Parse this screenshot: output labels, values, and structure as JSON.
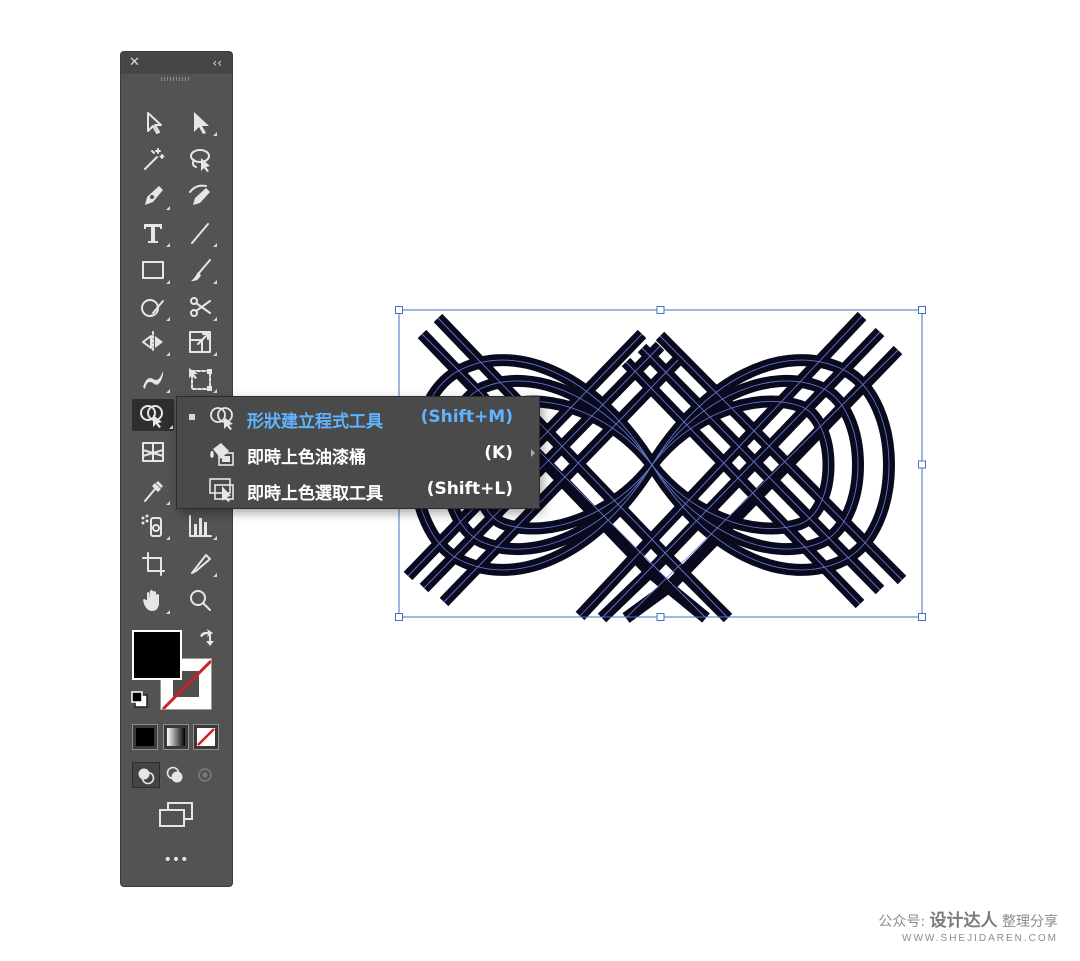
{
  "toolbar": {
    "close_glyph": "✕",
    "collapse_glyph": "‹‹",
    "tools": [
      {
        "name": "selection-tool",
        "icon": "arrow-outline-icon",
        "flyout": false
      },
      {
        "name": "direct-selection-tool",
        "icon": "arrow-solid-icon",
        "flyout": true
      },
      {
        "name": "magic-wand-tool",
        "icon": "magic-wand-icon",
        "flyout": false
      },
      {
        "name": "lasso-tool",
        "icon": "lasso-icon",
        "flyout": false
      },
      {
        "name": "pen-tool",
        "icon": "pen-icon",
        "flyout": true
      },
      {
        "name": "curvature-tool",
        "icon": "curvature-pen-icon",
        "flyout": false
      },
      {
        "name": "type-tool",
        "icon": "type-icon",
        "flyout": true
      },
      {
        "name": "line-segment-tool",
        "icon": "line-icon",
        "flyout": true
      },
      {
        "name": "rectangle-tool",
        "icon": "rectangle-icon",
        "flyout": true
      },
      {
        "name": "paintbrush-tool",
        "icon": "paintbrush-icon",
        "flyout": true
      },
      {
        "name": "shaper-tool",
        "icon": "shaper-icon",
        "flyout": true
      },
      {
        "name": "scissors-tool",
        "icon": "scissors-icon",
        "flyout": true
      },
      {
        "name": "reflect-tool",
        "icon": "reflect-icon",
        "flyout": true
      },
      {
        "name": "scale-tool",
        "icon": "scale-icon",
        "flyout": true
      },
      {
        "name": "width-tool",
        "icon": "width-icon",
        "flyout": true
      },
      {
        "name": "free-transform-tool",
        "icon": "free-transform-icon",
        "flyout": true
      },
      {
        "name": "shape-builder-tool",
        "icon": "shape-builder-icon",
        "flyout": true,
        "active": true
      },
      {
        "name": "perspective-grid-tool",
        "icon": "perspective-grid-icon",
        "flyout": false
      },
      {
        "name": "mesh-tool",
        "icon": "mesh-icon",
        "flyout": false
      },
      {
        "name": "gradient-tool",
        "icon": "gradient-icon",
        "flyout": false
      },
      {
        "name": "eyedropper-tool",
        "icon": "eyedropper-icon",
        "flyout": true
      },
      {
        "name": "blend-tool",
        "icon": "blend-icon",
        "flyout": false
      },
      {
        "name": "symbol-sprayer-tool",
        "icon": "symbol-sprayer-icon",
        "flyout": true
      },
      {
        "name": "column-graph-tool",
        "icon": "column-graph-icon",
        "flyout": true
      },
      {
        "name": "artboard-tool",
        "icon": "artboard-icon",
        "flyout": false
      },
      {
        "name": "slice-tool",
        "icon": "slice-icon",
        "flyout": true
      },
      {
        "name": "hand-tool",
        "icon": "hand-icon",
        "flyout": true
      },
      {
        "name": "zoom-tool",
        "icon": "zoom-icon",
        "flyout": false
      }
    ],
    "fill_color": "#000000",
    "stroke_color": "none",
    "more_glyph": "•••"
  },
  "flyout_menu": {
    "items": [
      {
        "label": "形狀建立程式工具",
        "shortcut": "(Shift+M)",
        "icon": "shape-builder-icon",
        "selected": true
      },
      {
        "label": "即時上色油漆桶",
        "shortcut": "(K)",
        "icon": "live-paint-bucket-icon",
        "selected": false
      },
      {
        "label": "即時上色選取工具",
        "shortcut": "(Shift+L)",
        "icon": "live-paint-selection-icon",
        "selected": false
      }
    ],
    "accent_color": "#5fb4ff"
  },
  "artwork": {
    "stroke_color": "#0a0a1e",
    "path_color": "#6f7fd8",
    "selection_color": "#4a6fbd"
  },
  "watermark": {
    "prefix": "公众号:",
    "brand": "设计达人",
    "suffix": "整理分享",
    "url": "WWW.SHEJIDAREN.COM"
  }
}
